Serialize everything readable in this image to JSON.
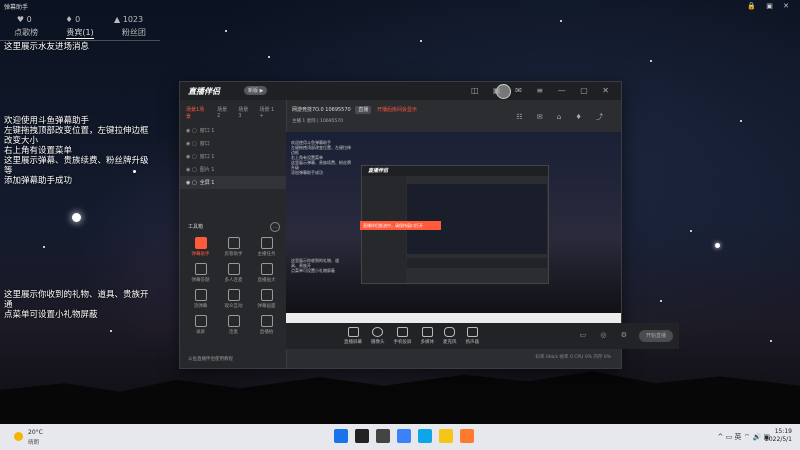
{
  "helper": {
    "title": "弹幕助手",
    "header_icons": "🔒 ▣ ✕",
    "stats": [
      {
        "icon": "♥",
        "value": "0"
      },
      {
        "icon": "♦",
        "value": "0"
      },
      {
        "icon": "▲",
        "value": "1023"
      }
    ],
    "tabs": [
      "点歌榜",
      "贵宾(1)",
      "粉丝团"
    ],
    "message_area_hint": "这里展示水友进场消息",
    "welcome_lines": [
      "欢迎使用斗鱼弹幕助手",
      "左键拖拽顶部改变位置，左键拉伸边框",
      "改变大小",
      "右上角有设置菜单",
      "这里展示弹幕、贵族续费、粉丝牌升级",
      "等",
      "添加弹幕助手成功"
    ],
    "gift_lines": [
      "这里展示你收到的礼物、道具、贵族开",
      "通",
      "点菜单可设置小礼物屏蔽"
    ]
  },
  "app": {
    "logo": "直播伴侣",
    "version_badge": "新版 ▶",
    "titlebar_icons": "◫ ▣ ✉ ≡ — ▢ ✕",
    "sidebar_tabs": [
      "场景1场景",
      "场景2",
      "场景3",
      "场景 1 +"
    ],
    "scenes": [
      "窗口 1",
      "窗口",
      "窗口 1",
      "图片 1",
      "全屏 1"
    ],
    "tools_label": "工具箱",
    "tools_more": "…",
    "tools": [
      "弹幕助手",
      "房管助手",
      "主播任务",
      "弹幕答题",
      "多人连麦",
      "直播画大",
      "流弹幕",
      "观众互动",
      "弹幕画面",
      "录屏",
      "连麦",
      "直播拍"
    ],
    "sidebar_footer": "斗鱼直播伴侣使用教程",
    "room": {
      "name": "网游竞技7O.0",
      "id": "10695570",
      "btn": "直播",
      "link": "开播后房间会显示"
    },
    "room_sub": "主播 1 星际 | 10695570",
    "main_icons": "☷ ✉ ⌂ ♦ ⤴",
    "bottom_buttons": [
      "直播屏幕",
      "摄像头",
      "手机投屏",
      "多媒体",
      "麦克风",
      "扬声器"
    ],
    "bottom_right_icons": "▭ ◎ ⚙",
    "start_button": "开始直播",
    "status_line": "码率 0kb/s  帧率 0  CPU 0%  内存 0%",
    "popup_text": "直播伴侣推流中，请保持窗口打开"
  },
  "taskbar": {
    "weather_temp": "20°C",
    "weather_cond": "晴朗",
    "tray_text": "^ ▭ 英 ⌔ 🔊 ▣",
    "time": "15:19",
    "date": "2022/5/1",
    "app_icons": [
      {
        "name": "windows-start-icon",
        "color": "#1a73e8"
      },
      {
        "name": "search-icon",
        "color": "#222222"
      },
      {
        "name": "task-view-icon",
        "color": "#444444"
      },
      {
        "name": "widgets-icon",
        "color": "#3b82f6"
      },
      {
        "name": "edge-browser-icon",
        "color": "#0ea5e9"
      },
      {
        "name": "file-explorer-icon",
        "color": "#f5c518"
      },
      {
        "name": "streaming-app-icon",
        "color": "#ff7a2f"
      }
    ]
  },
  "colors": {
    "accent": "#ff5a3c"
  }
}
